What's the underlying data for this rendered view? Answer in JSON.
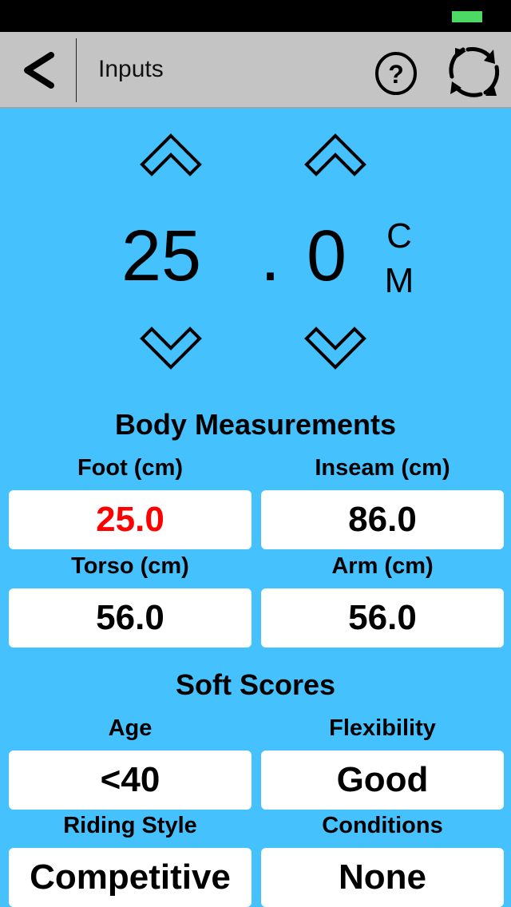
{
  "status_bar": {
    "battery_color": "#4cd964"
  },
  "nav": {
    "back_icon": "chevron-left-icon",
    "title": "Inputs",
    "help_icon": "question-circle-icon",
    "refresh_icon": "refresh-icon"
  },
  "picker": {
    "whole": "25",
    "separator": ".",
    "decimal": "0",
    "unit_line1": "C",
    "unit_line2": "M",
    "up_icon": "chevron-up-outline-icon",
    "down_icon": "chevron-down-outline-icon"
  },
  "body_measurements": {
    "title": "Body Measurements",
    "fields": [
      {
        "label": "Foot (cm)",
        "value": "25.0",
        "selected": true,
        "color": "#ff0000"
      },
      {
        "label": "Inseam (cm)",
        "value": "86.0"
      },
      {
        "label": "Torso (cm)",
        "value": "56.0"
      },
      {
        "label": "Arm (cm)",
        "value": "56.0"
      }
    ]
  },
  "soft_scores": {
    "title": "Soft Scores",
    "fields": [
      {
        "label": "Age",
        "value": "<40"
      },
      {
        "label": "Flexibility",
        "value": "Good"
      },
      {
        "label": "Riding Style",
        "value": "Competitive"
      },
      {
        "label": "Conditions",
        "value": "None"
      }
    ]
  },
  "colors": {
    "background": "#45c1fe",
    "nav_bar": "#c4c4c4"
  }
}
